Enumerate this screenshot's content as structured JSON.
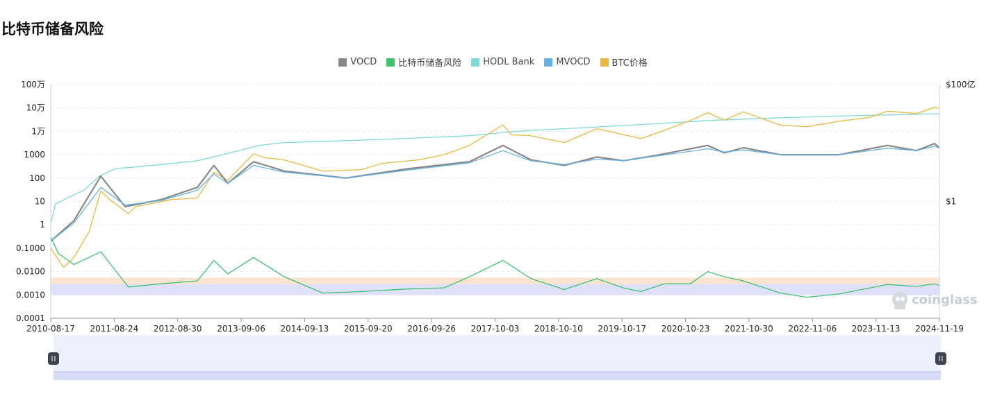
{
  "page": {
    "title": "比特币储备风险"
  },
  "legend": [
    {
      "label": "VOCD",
      "color": "#888888"
    },
    {
      "label": "比特币储备风险",
      "color": "#3ec46d"
    },
    {
      "label": "HODL Bank",
      "color": "#7ed9d9"
    },
    {
      "label": "MVOCD",
      "color": "#63b3e8"
    },
    {
      "label": "BTC价格",
      "color": "#e9b840"
    }
  ],
  "watermark": {
    "text": "coinglass"
  },
  "chart_data": {
    "type": "line",
    "title": "比特币储备风险",
    "x_ticks": [
      "2010-08-17",
      "2011-08-24",
      "2012-08-30",
      "2013-09-06",
      "2014-09-13",
      "2015-09-20",
      "2016-09-26",
      "2017-10-03",
      "2018-10-10",
      "2019-10-17",
      "2020-10-23",
      "2021-10-30",
      "2022-11-06",
      "2023-11-13",
      "2024-11-19"
    ],
    "x_range": [
      "2010-08-17",
      "2025-01-15"
    ],
    "y_left": {
      "scale": "log",
      "min": 0.0001,
      "max": 1000000,
      "tick_labels": [
        "0.0001",
        "0.0010",
        "0.0100",
        "0.1000",
        "1",
        "10",
        "100",
        "1000",
        "1万",
        "10万",
        "100万"
      ]
    },
    "y_right": {
      "scale": "log",
      "tick_labels": [
        "$1",
        "$100亿"
      ]
    },
    "bands": [
      {
        "name": "high-risk-band",
        "from": 0.002,
        "to": 0.0055,
        "color": "#fbe3d2"
      },
      {
        "name": "low-risk-band",
        "from": 0.00098,
        "to": 0.0029,
        "color": "#dfe1fa"
      }
    ],
    "series": [
      {
        "name": "HODL Bank",
        "color": "#7ed9d9",
        "points": [
          [
            "2010-08-17",
            1.2
          ],
          [
            "2010-09-15",
            8
          ],
          [
            "2010-12-01",
            15
          ],
          [
            "2011-03-01",
            30
          ],
          [
            "2011-06-01",
            120
          ],
          [
            "2011-09-01",
            250
          ],
          [
            "2012-01-01",
            300
          ],
          [
            "2012-06-01",
            380
          ],
          [
            "2013-01-01",
            550
          ],
          [
            "2013-06-01",
            1000
          ],
          [
            "2014-01-01",
            2500
          ],
          [
            "2014-06-01",
            3300
          ],
          [
            "2015-06-01",
            4000
          ],
          [
            "2016-06-01",
            5000
          ],
          [
            "2017-06-01",
            6500
          ],
          [
            "2018-01-01",
            9000
          ],
          [
            "2018-06-01",
            11000
          ],
          [
            "2019-06-01",
            15000
          ],
          [
            "2020-06-01",
            21000
          ],
          [
            "2021-06-01",
            30000
          ],
          [
            "2022-06-01",
            38000
          ],
          [
            "2023-06-01",
            45000
          ],
          [
            "2024-06-01",
            52000
          ],
          [
            "2025-01-15",
            57000
          ]
        ]
      },
      {
        "name": "BTC价格",
        "color": "#e9b840",
        "points": [
          [
            "2010-08-17",
            0.1
          ],
          [
            "2010-11-01",
            0.015
          ],
          [
            "2011-01-01",
            0.04
          ],
          [
            "2011-04-01",
            0.5
          ],
          [
            "2011-06-10",
            28
          ],
          [
            "2011-08-01",
            12
          ],
          [
            "2011-11-20",
            3
          ],
          [
            "2012-01-01",
            6
          ],
          [
            "2012-08-01",
            12
          ],
          [
            "2013-01-01",
            14
          ],
          [
            "2013-04-10",
            180
          ],
          [
            "2013-07-01",
            80
          ],
          [
            "2013-11-30",
            1100
          ],
          [
            "2014-02-01",
            750
          ],
          [
            "2014-06-01",
            600
          ],
          [
            "2015-01-15",
            200
          ],
          [
            "2015-09-01",
            230
          ],
          [
            "2016-01-01",
            430
          ],
          [
            "2016-08-01",
            600
          ],
          [
            "2017-01-01",
            1000
          ],
          [
            "2017-06-01",
            2500
          ],
          [
            "2017-12-17",
            19000
          ],
          [
            "2018-02-06",
            7000
          ],
          [
            "2018-06-01",
            6500
          ],
          [
            "2018-12-15",
            3300
          ],
          [
            "2019-06-26",
            13000
          ],
          [
            "2019-12-01",
            7200
          ],
          [
            "2020-03-13",
            4900
          ],
          [
            "2020-07-01",
            9200
          ],
          [
            "2020-12-31",
            29000
          ],
          [
            "2021-04-14",
            63000
          ],
          [
            "2021-07-20",
            30000
          ],
          [
            "2021-11-10",
            68000
          ],
          [
            "2022-06-18",
            18500
          ],
          [
            "2022-11-21",
            15800
          ],
          [
            "2023-06-01",
            27000
          ],
          [
            "2023-12-01",
            40000
          ],
          [
            "2024-03-14",
            73000
          ],
          [
            "2024-09-01",
            58000
          ],
          [
            "2024-12-17",
            106000
          ],
          [
            "2025-01-15",
            97000
          ]
        ]
      },
      {
        "name": "VOCD",
        "color": "#888888",
        "points": [
          [
            "2010-08-17",
            0.2
          ],
          [
            "2011-01-01",
            1.5
          ],
          [
            "2011-06-10",
            120
          ],
          [
            "2011-11-01",
            6
          ],
          [
            "2012-06-01",
            12
          ],
          [
            "2013-01-01",
            40
          ],
          [
            "2013-04-10",
            350
          ],
          [
            "2013-07-01",
            60
          ],
          [
            "2013-12-01",
            500
          ],
          [
            "2014-06-01",
            200
          ],
          [
            "2015-06-01",
            100
          ],
          [
            "2016-06-01",
            250
          ],
          [
            "2017-06-01",
            500
          ],
          [
            "2017-12-17",
            2500
          ],
          [
            "2018-06-01",
            600
          ],
          [
            "2018-12-15",
            350
          ],
          [
            "2019-06-26",
            800
          ],
          [
            "2019-12-01",
            550
          ],
          [
            "2020-06-01",
            900
          ],
          [
            "2021-04-14",
            2500
          ],
          [
            "2021-07-20",
            1200
          ],
          [
            "2021-11-10",
            2000
          ],
          [
            "2022-06-18",
            1000
          ],
          [
            "2023-06-01",
            1000
          ],
          [
            "2024-03-14",
            2500
          ],
          [
            "2024-09-01",
            1500
          ],
          [
            "2024-12-17",
            3000
          ],
          [
            "2025-01-15",
            2000
          ]
        ]
      },
      {
        "name": "MVOCD",
        "color": "#63b3e8",
        "points": [
          [
            "2010-08-17",
            0.2
          ],
          [
            "2011-01-01",
            1.2
          ],
          [
            "2011-06-10",
            40
          ],
          [
            "2011-11-01",
            7
          ],
          [
            "2012-06-01",
            11
          ],
          [
            "2013-01-01",
            30
          ],
          [
            "2013-04-10",
            150
          ],
          [
            "2013-07-01",
            60
          ],
          [
            "2013-12-01",
            350
          ],
          [
            "2014-06-01",
            180
          ],
          [
            "2015-06-01",
            100
          ],
          [
            "2016-06-01",
            220
          ],
          [
            "2017-06-01",
            450
          ],
          [
            "2017-12-17",
            1500
          ],
          [
            "2018-06-01",
            550
          ],
          [
            "2018-12-15",
            380
          ],
          [
            "2019-06-26",
            650
          ],
          [
            "2019-12-01",
            550
          ],
          [
            "2020-06-01",
            850
          ],
          [
            "2021-04-14",
            1800
          ],
          [
            "2021-07-20",
            1300
          ],
          [
            "2021-11-10",
            1600
          ],
          [
            "2022-06-18",
            1000
          ],
          [
            "2023-06-01",
            1000
          ],
          [
            "2024-03-14",
            1900
          ],
          [
            "2024-09-01",
            1500
          ],
          [
            "2024-12-17",
            2300
          ],
          [
            "2025-01-15",
            1900
          ]
        ]
      },
      {
        "name": "比特币储备风险",
        "color": "#3ec46d",
        "points": [
          [
            "2010-08-17",
            0.3
          ],
          [
            "2010-10-01",
            0.06
          ],
          [
            "2011-01-01",
            0.02
          ],
          [
            "2011-06-10",
            0.07
          ],
          [
            "2011-11-20",
            0.0022
          ],
          [
            "2012-06-01",
            0.003
          ],
          [
            "2013-01-01",
            0.004
          ],
          [
            "2013-04-10",
            0.03
          ],
          [
            "2013-07-01",
            0.008
          ],
          [
            "2013-11-30",
            0.04
          ],
          [
            "2014-06-01",
            0.006
          ],
          [
            "2015-01-15",
            0.0012
          ],
          [
            "2015-09-01",
            0.0014
          ],
          [
            "2016-06-01",
            0.0018
          ],
          [
            "2017-01-01",
            0.002
          ],
          [
            "2017-06-01",
            0.006
          ],
          [
            "2017-12-17",
            0.03
          ],
          [
            "2018-06-01",
            0.005
          ],
          [
            "2018-12-15",
            0.0017
          ],
          [
            "2019-06-26",
            0.005
          ],
          [
            "2019-12-01",
            0.002
          ],
          [
            "2020-03-13",
            0.0014
          ],
          [
            "2020-08-01",
            0.003
          ],
          [
            "2020-12-31",
            0.003
          ],
          [
            "2021-04-14",
            0.01
          ],
          [
            "2021-07-20",
            0.006
          ],
          [
            "2021-11-10",
            0.004
          ],
          [
            "2022-06-18",
            0.0012
          ],
          [
            "2022-11-21",
            0.0008
          ],
          [
            "2023-06-01",
            0.0011
          ],
          [
            "2024-03-14",
            0.0028
          ],
          [
            "2024-09-01",
            0.0023
          ],
          [
            "2024-12-17",
            0.003
          ],
          [
            "2025-01-15",
            0.0025
          ]
        ]
      }
    ]
  }
}
